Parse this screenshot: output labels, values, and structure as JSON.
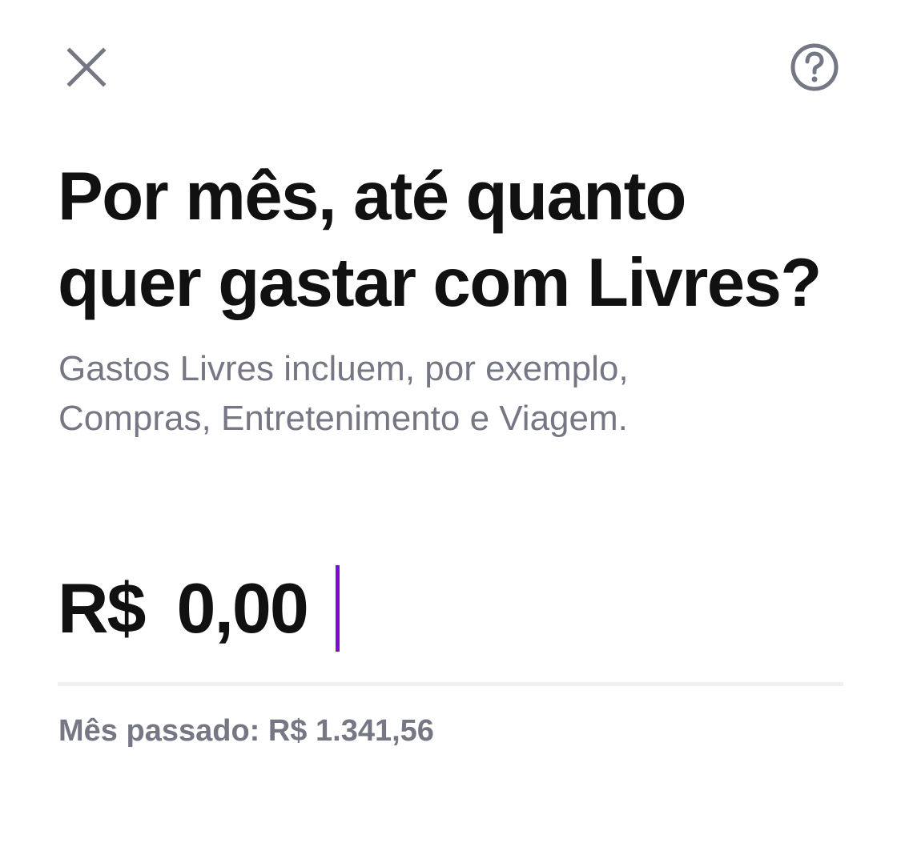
{
  "header": {
    "close_icon": "close-icon",
    "help_icon": "question-circle-icon"
  },
  "title": {
    "line1": "Por mês, até quanto",
    "line2": "quer gastar com Livres?"
  },
  "subtitle": {
    "line1": "Gastos Livres incluem, por exemplo,",
    "line2": "Compras, Entretenimento e Viagem."
  },
  "amount": {
    "currency": "R$",
    "value": "0,00"
  },
  "last_month": {
    "text": "Mês passado: R$ 1.341,56"
  },
  "colors": {
    "accent": "#820ad1",
    "icon": "#757884",
    "text": "#111111",
    "muted": "#757884",
    "divider": "#eff0f4"
  }
}
